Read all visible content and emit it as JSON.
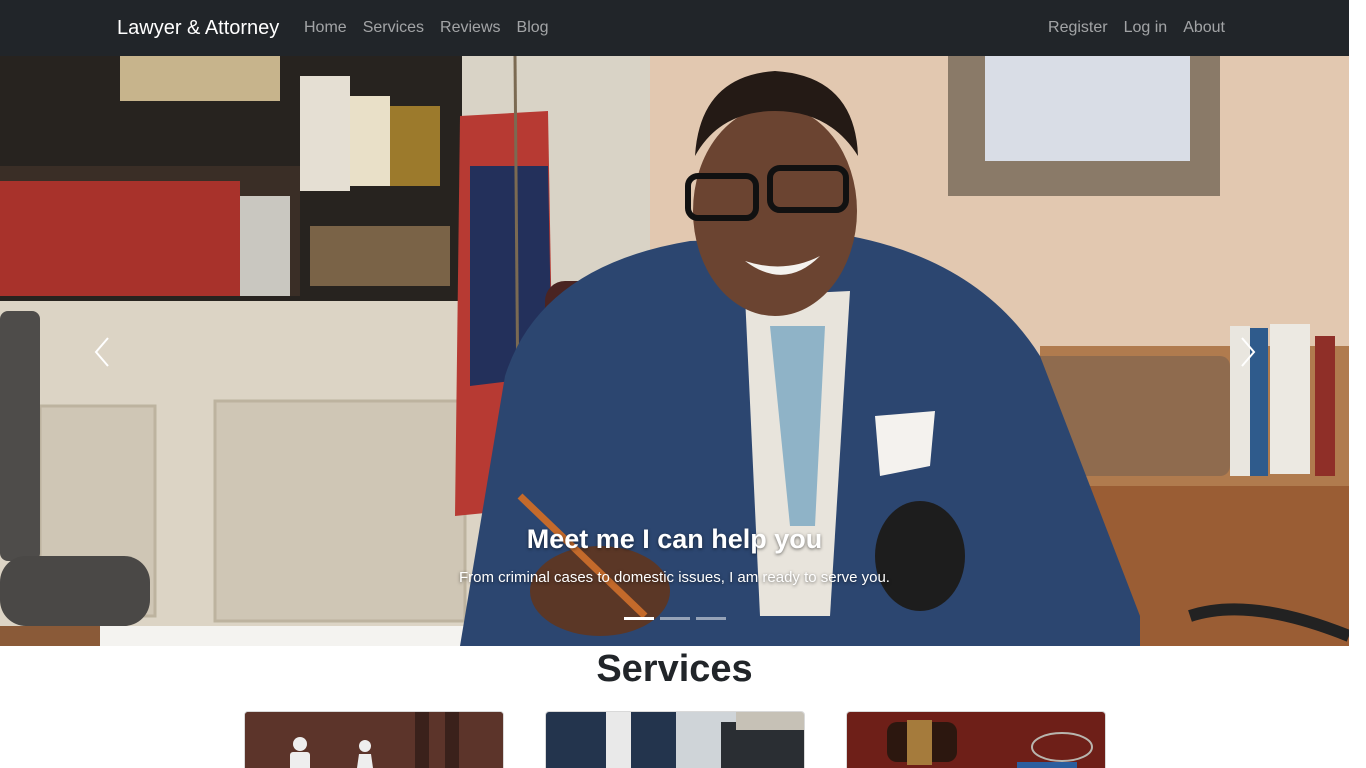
{
  "navbar": {
    "brand": "Lawyer & Attorney",
    "left_links": [
      "Home",
      "Services",
      "Reviews",
      "Blog"
    ],
    "right_links": [
      "Register",
      "Log in",
      "About"
    ]
  },
  "hero": {
    "title": "Meet me I can help you",
    "text": "From criminal cases to domestic issues, I am ready to serve you.",
    "prev_icon": "chevron-left-icon",
    "next_icon": "chevron-right-icon",
    "slide_count": 3,
    "active_slide": 1
  },
  "services": {
    "heading": "Services",
    "cards": [
      "family-law-image",
      "business-law-image",
      "criminal-law-gavel-image"
    ]
  },
  "colors": {
    "navbar_bg": "#212529",
    "link": "rgba(255,255,255,0.58)",
    "heading": "#212529"
  }
}
